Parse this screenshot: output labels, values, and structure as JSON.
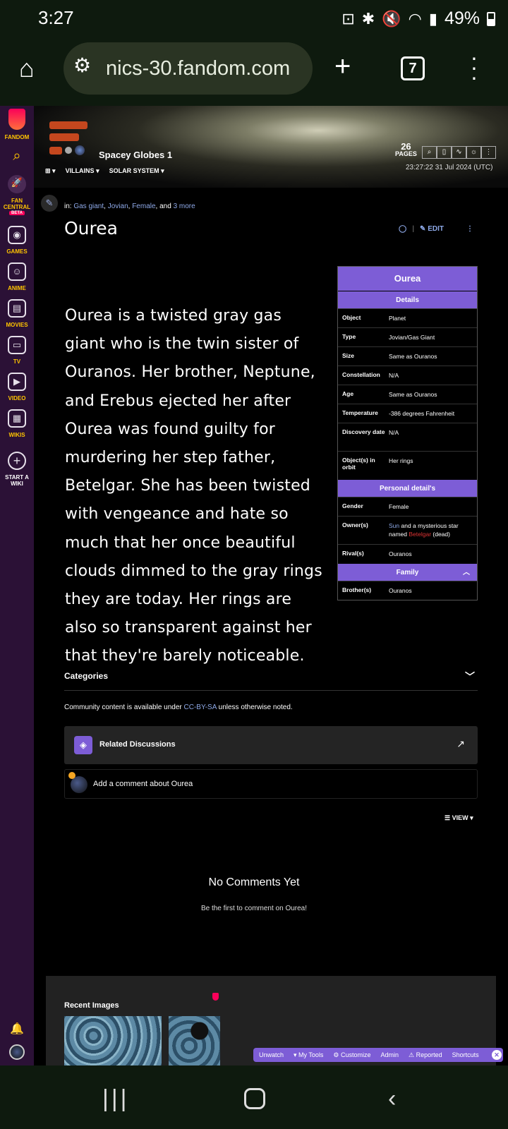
{
  "status": {
    "time": "3:27",
    "battery": "49%"
  },
  "browser": {
    "url": "nics-30.fandom.com",
    "tab_count": "7"
  },
  "rail": {
    "items": [
      {
        "label": "FANDOM",
        "icon": "fandom-logo-icon"
      },
      {
        "label": "",
        "icon": "search-icon"
      },
      {
        "label": "FAN CENTRAL",
        "badge": "BETA",
        "icon": "rocket-icon"
      },
      {
        "label": "GAMES",
        "icon": "gamepad-icon"
      },
      {
        "label": "ANIME",
        "icon": "anime-icon"
      },
      {
        "label": "MOVIES",
        "icon": "clapper-icon"
      },
      {
        "label": "TV",
        "icon": "tv-icon"
      },
      {
        "label": "VIDEO",
        "icon": "play-icon"
      },
      {
        "label": "WIKIS",
        "icon": "book-icon"
      },
      {
        "label": "START A WIKI",
        "icon": "plus-icon"
      }
    ]
  },
  "header": {
    "wiki_name": "Spacey Globes 1",
    "nav": [
      "VILLAINS",
      "SOLAR SYSTEM"
    ],
    "pages_count": "26",
    "pages_label": "PAGES",
    "timestamp": "23:27:22 31 Jul 2024 (UTC)"
  },
  "article": {
    "in_label": "in:",
    "categories": [
      "Gas giant",
      "Jovian",
      "Female"
    ],
    "and_label": ", and",
    "more": "3 more",
    "title": "Ourea",
    "edit_label": "EDIT",
    "body": "Ourea is a twisted gray gas giant who is the twin sister of Ouranos. Her brother, Neptune, and Erebus ejected her after Ourea was found guilty for murdering her step father, Betelgar. She has been twisted with vengeance and hate so much that her once beautiful clouds dimmed to the gray rings they are today. Her rings are also so transparent against her that they're barely noticeable."
  },
  "infobox": {
    "title": "Ourea",
    "sections": [
      {
        "heading": "Details",
        "rows": [
          {
            "key": "Object",
            "value": "Planet"
          },
          {
            "key": "Type",
            "value": "Jovian/Gas Giant"
          },
          {
            "key": "Size",
            "value": "Same as Ouranos"
          },
          {
            "key": "Constellation",
            "value": "N/A"
          },
          {
            "key": "Age",
            "value": "Same as Ouranos"
          },
          {
            "key": "Temperature",
            "value": "-386 degrees Fahrenheit"
          },
          {
            "key": "Discovery date",
            "value": "N/A"
          },
          {
            "key": "Object(s) in orbit",
            "value": "Her rings"
          }
        ]
      },
      {
        "heading": "Personal detail's",
        "rows": [
          {
            "key": "Gender",
            "value": "Female"
          },
          {
            "key": "Owner(s)",
            "value_parts": [
              "Sun",
              " and a mysterious star named ",
              "Betelgar",
              " (dead)"
            ]
          },
          {
            "key": "Rival(s)",
            "value": "Ouranos"
          }
        ]
      },
      {
        "heading": "Family",
        "rows": [
          {
            "key": "Brother(s)",
            "value": "Ouranos"
          }
        ]
      }
    ]
  },
  "footer": {
    "categories_label": "Categories",
    "license_prefix": "Community content is available under ",
    "license_link": "CC-BY-SA",
    "license_suffix": " unless otherwise noted.",
    "related_label": "Related Discussions",
    "comment_placeholder": "Add a comment about Ourea",
    "view_label": "VIEW",
    "no_comments_title": "No Comments Yet",
    "no_comments_sub": "Be the first to comment on Ourea!",
    "recent_images_label": "Recent Images"
  },
  "admin_toolbar": [
    "Unwatch",
    "My Tools",
    "Customize",
    "Admin",
    "Reported",
    "Shortcuts"
  ],
  "colors": {
    "accent": "#7d5dd6",
    "link": "#8ea9e8",
    "rail_bg": "#2b1136",
    "rail_label": "#ffc500",
    "browser_bg": "#0e1a0e"
  }
}
